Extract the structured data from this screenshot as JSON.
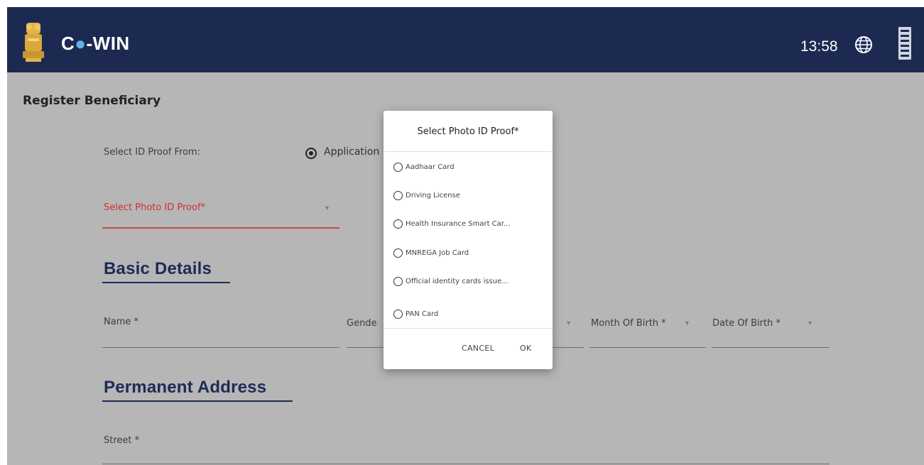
{
  "header": {
    "brand_prefix": "C",
    "brand_dot": "●",
    "brand_suffix": "-WIN",
    "time": "13:58",
    "colors": {
      "bar": "#1c2a52",
      "text": "#ffffff"
    },
    "icons": [
      "emblem-icon",
      "globe-icon",
      "undp-logo-icon"
    ]
  },
  "page": {
    "title": "Register Beneficiary",
    "id_proof_from_label": "Select ID Proof From:",
    "id_proof_from_value": "Application",
    "photo_id_label": "Select Photo ID Proof*",
    "basic_details_heading": "Basic Details",
    "fields": {
      "name": "Name *",
      "gender": "Gende",
      "month_of_birth": "Month Of Birth *",
      "date_of_birth": "Date Of Birth *"
    },
    "permanent_address_heading": "Permanent Address",
    "street_label": "Street *"
  },
  "dialog": {
    "title": "Select Photo ID Proof*",
    "options": [
      "Aadhaar Card",
      "Driving License",
      "Health Insurance Smart Car...",
      "MNREGA Job Card",
      "Official identity cards issue...",
      "PAN Card"
    ],
    "cancel_label": "CANCEL",
    "ok_label": "OK"
  }
}
